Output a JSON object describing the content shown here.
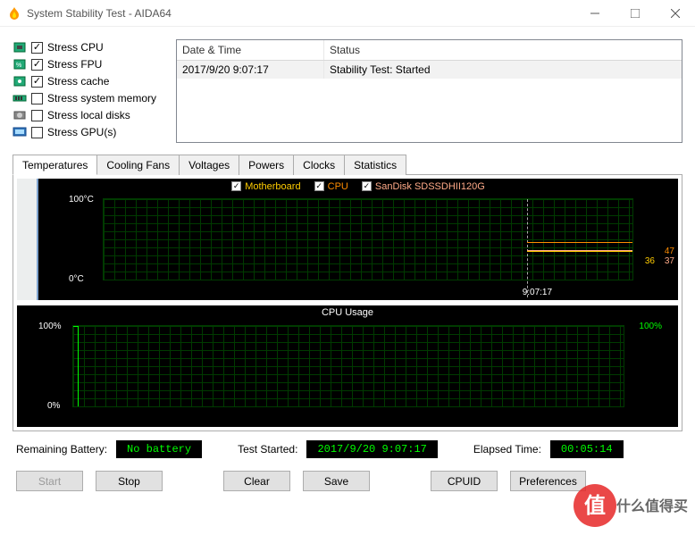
{
  "window": {
    "title": "System Stability Test - AIDA64"
  },
  "stress": [
    {
      "label": "Stress CPU",
      "checked": true,
      "icon": "cpu"
    },
    {
      "label": "Stress FPU",
      "checked": true,
      "icon": "fpu"
    },
    {
      "label": "Stress cache",
      "checked": true,
      "icon": "cache"
    },
    {
      "label": "Stress system memory",
      "checked": false,
      "icon": "ram"
    },
    {
      "label": "Stress local disks",
      "checked": false,
      "icon": "disk"
    },
    {
      "label": "Stress GPU(s)",
      "checked": false,
      "icon": "gpu"
    }
  ],
  "event_table": {
    "headers": {
      "dt": "Date & Time",
      "st": "Status"
    },
    "rows": [
      {
        "dt": "2017/9/20 9:07:17",
        "st": "Stability Test: Started"
      }
    ]
  },
  "tabs": [
    "Temperatures",
    "Cooling Fans",
    "Voltages",
    "Powers",
    "Clocks",
    "Statistics"
  ],
  "active_tab": 0,
  "chart_data": [
    {
      "type": "line",
      "title": "",
      "ylabel": "°C",
      "ylim": [
        0,
        100
      ],
      "y_ticks": [
        "100°C",
        "0°C"
      ],
      "x_ticks": [
        "9:07:17"
      ],
      "series": [
        {
          "name": "Motherboard",
          "color": "#ffcc00",
          "current": 36
        },
        {
          "name": "CPU",
          "color": "#ff8c00",
          "current": 47
        },
        {
          "name": "SanDisk SDSSDHII120G",
          "color": "#ffaa88",
          "current": 37
        }
      ]
    },
    {
      "type": "line",
      "title": "CPU Usage",
      "ylabel": "%",
      "ylim": [
        0,
        100
      ],
      "y_ticks": [
        "100%",
        "0%"
      ],
      "series": [
        {
          "name": "CPU",
          "color": "#00ff00",
          "current": 100
        }
      ],
      "right_label": "100%"
    }
  ],
  "status": {
    "battery_label": "Remaining Battery:",
    "battery_value": "No battery",
    "started_label": "Test Started:",
    "started_value": "2017/9/20 9:07:17",
    "elapsed_label": "Elapsed Time:",
    "elapsed_value": "00:05:14"
  },
  "buttons": {
    "start": "Start",
    "stop": "Stop",
    "clear": "Clear",
    "save": "Save",
    "cpuid": "CPUID",
    "prefs": "Preferences"
  },
  "watermark": "值 什么值得买"
}
